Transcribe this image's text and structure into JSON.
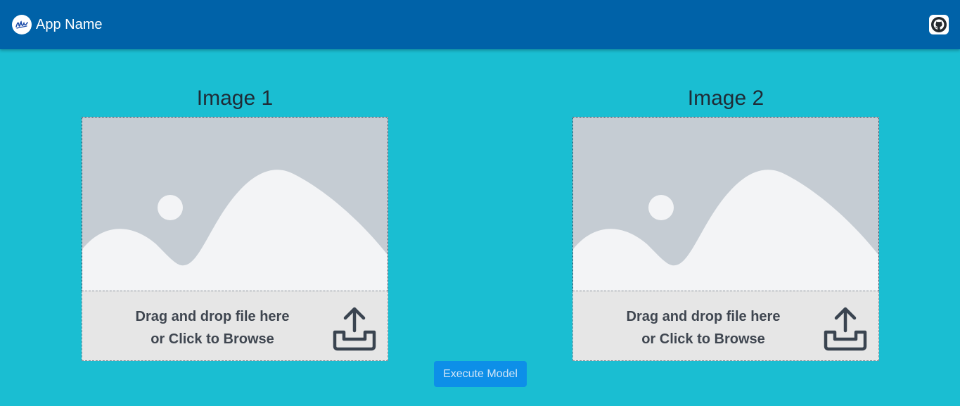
{
  "app": {
    "name": "App Name",
    "logo_icon": "signature-logo-icon",
    "github_icon": "github-icon"
  },
  "colors": {
    "navbar": "#0062a8",
    "background": "#1abed2",
    "button": "#0d8fe8",
    "dropzone": "#e6e6e6",
    "placeholder_sky": "#c5ccd3",
    "placeholder_hills": "#f3f4f6"
  },
  "panels": [
    {
      "title": "Image 1",
      "placeholder_icon": "image-placeholder-icon",
      "dropzone": {
        "line1": "Drag and drop file here",
        "line2": "or Click to Browse",
        "icon": "upload-icon"
      }
    },
    {
      "title": "Image 2",
      "placeholder_icon": "image-placeholder-icon",
      "dropzone": {
        "line1": "Drag and drop file here",
        "line2": "or Click to Browse",
        "icon": "upload-icon"
      }
    }
  ],
  "actions": {
    "execute_label": "Execute Model"
  }
}
